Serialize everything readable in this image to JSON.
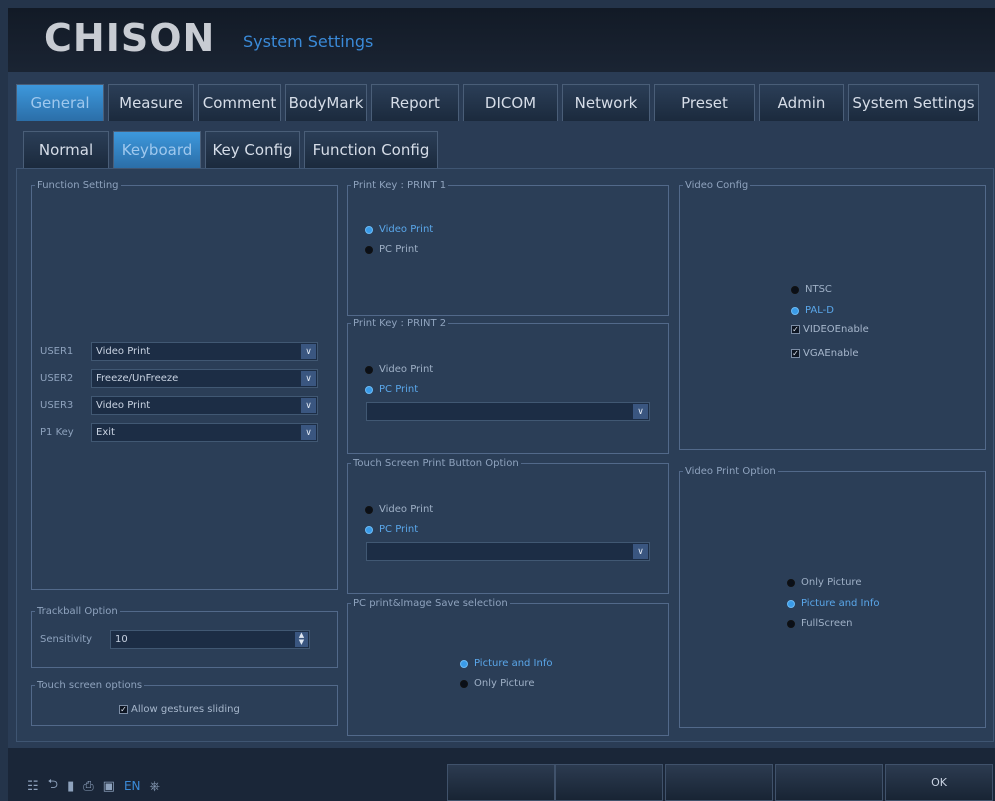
{
  "header": {
    "brand": "CHISON",
    "subtitle": "System Settings"
  },
  "main_tabs": [
    "General",
    "Measure",
    "Comment",
    "BodyMark",
    "Report",
    "DICOM",
    "Network",
    "Preset",
    "Admin",
    "System Settings"
  ],
  "sub_tabs": [
    "Normal",
    "Keyboard",
    "Key Config",
    "Function Config"
  ],
  "function_setting": {
    "legend": "Function Setting",
    "rows": [
      {
        "label": "USER1",
        "value": "Video Print"
      },
      {
        "label": "USER2",
        "value": "Freeze/UnFreeze"
      },
      {
        "label": "USER3",
        "value": "Video Print"
      },
      {
        "label": "P1 Key",
        "value": "Exit"
      }
    ]
  },
  "trackball": {
    "legend": "Trackball Option",
    "label": "Sensitivity",
    "value": "10"
  },
  "touch_options": {
    "legend": "Touch screen options",
    "checkbox": "Allow gestures sliding"
  },
  "print1": {
    "legend": "Print Key : PRINT 1",
    "options": [
      "Video Print",
      "PC Print"
    ]
  },
  "print2": {
    "legend": "Print Key : PRINT 2",
    "options": [
      "Video Print",
      "PC Print"
    ]
  },
  "touch_print": {
    "legend": "Touch Screen Print Button Option",
    "options": [
      "Video Print",
      "PC Print"
    ]
  },
  "pc_save": {
    "legend": "PC print&Image Save selection",
    "options": [
      "Picture and Info",
      "Only Picture"
    ]
  },
  "video_config": {
    "legend": "Video Config",
    "radios": [
      "NTSC",
      "PAL-D"
    ],
    "checks": [
      "VIDEOEnable",
      "VGAEnable"
    ]
  },
  "video_print": {
    "legend": "Video Print Option",
    "options": [
      "Only Picture",
      "Picture and Info",
      "FullScreen"
    ]
  },
  "status": {
    "lang": "EN"
  },
  "softkeys": {
    "ok": "OK"
  }
}
